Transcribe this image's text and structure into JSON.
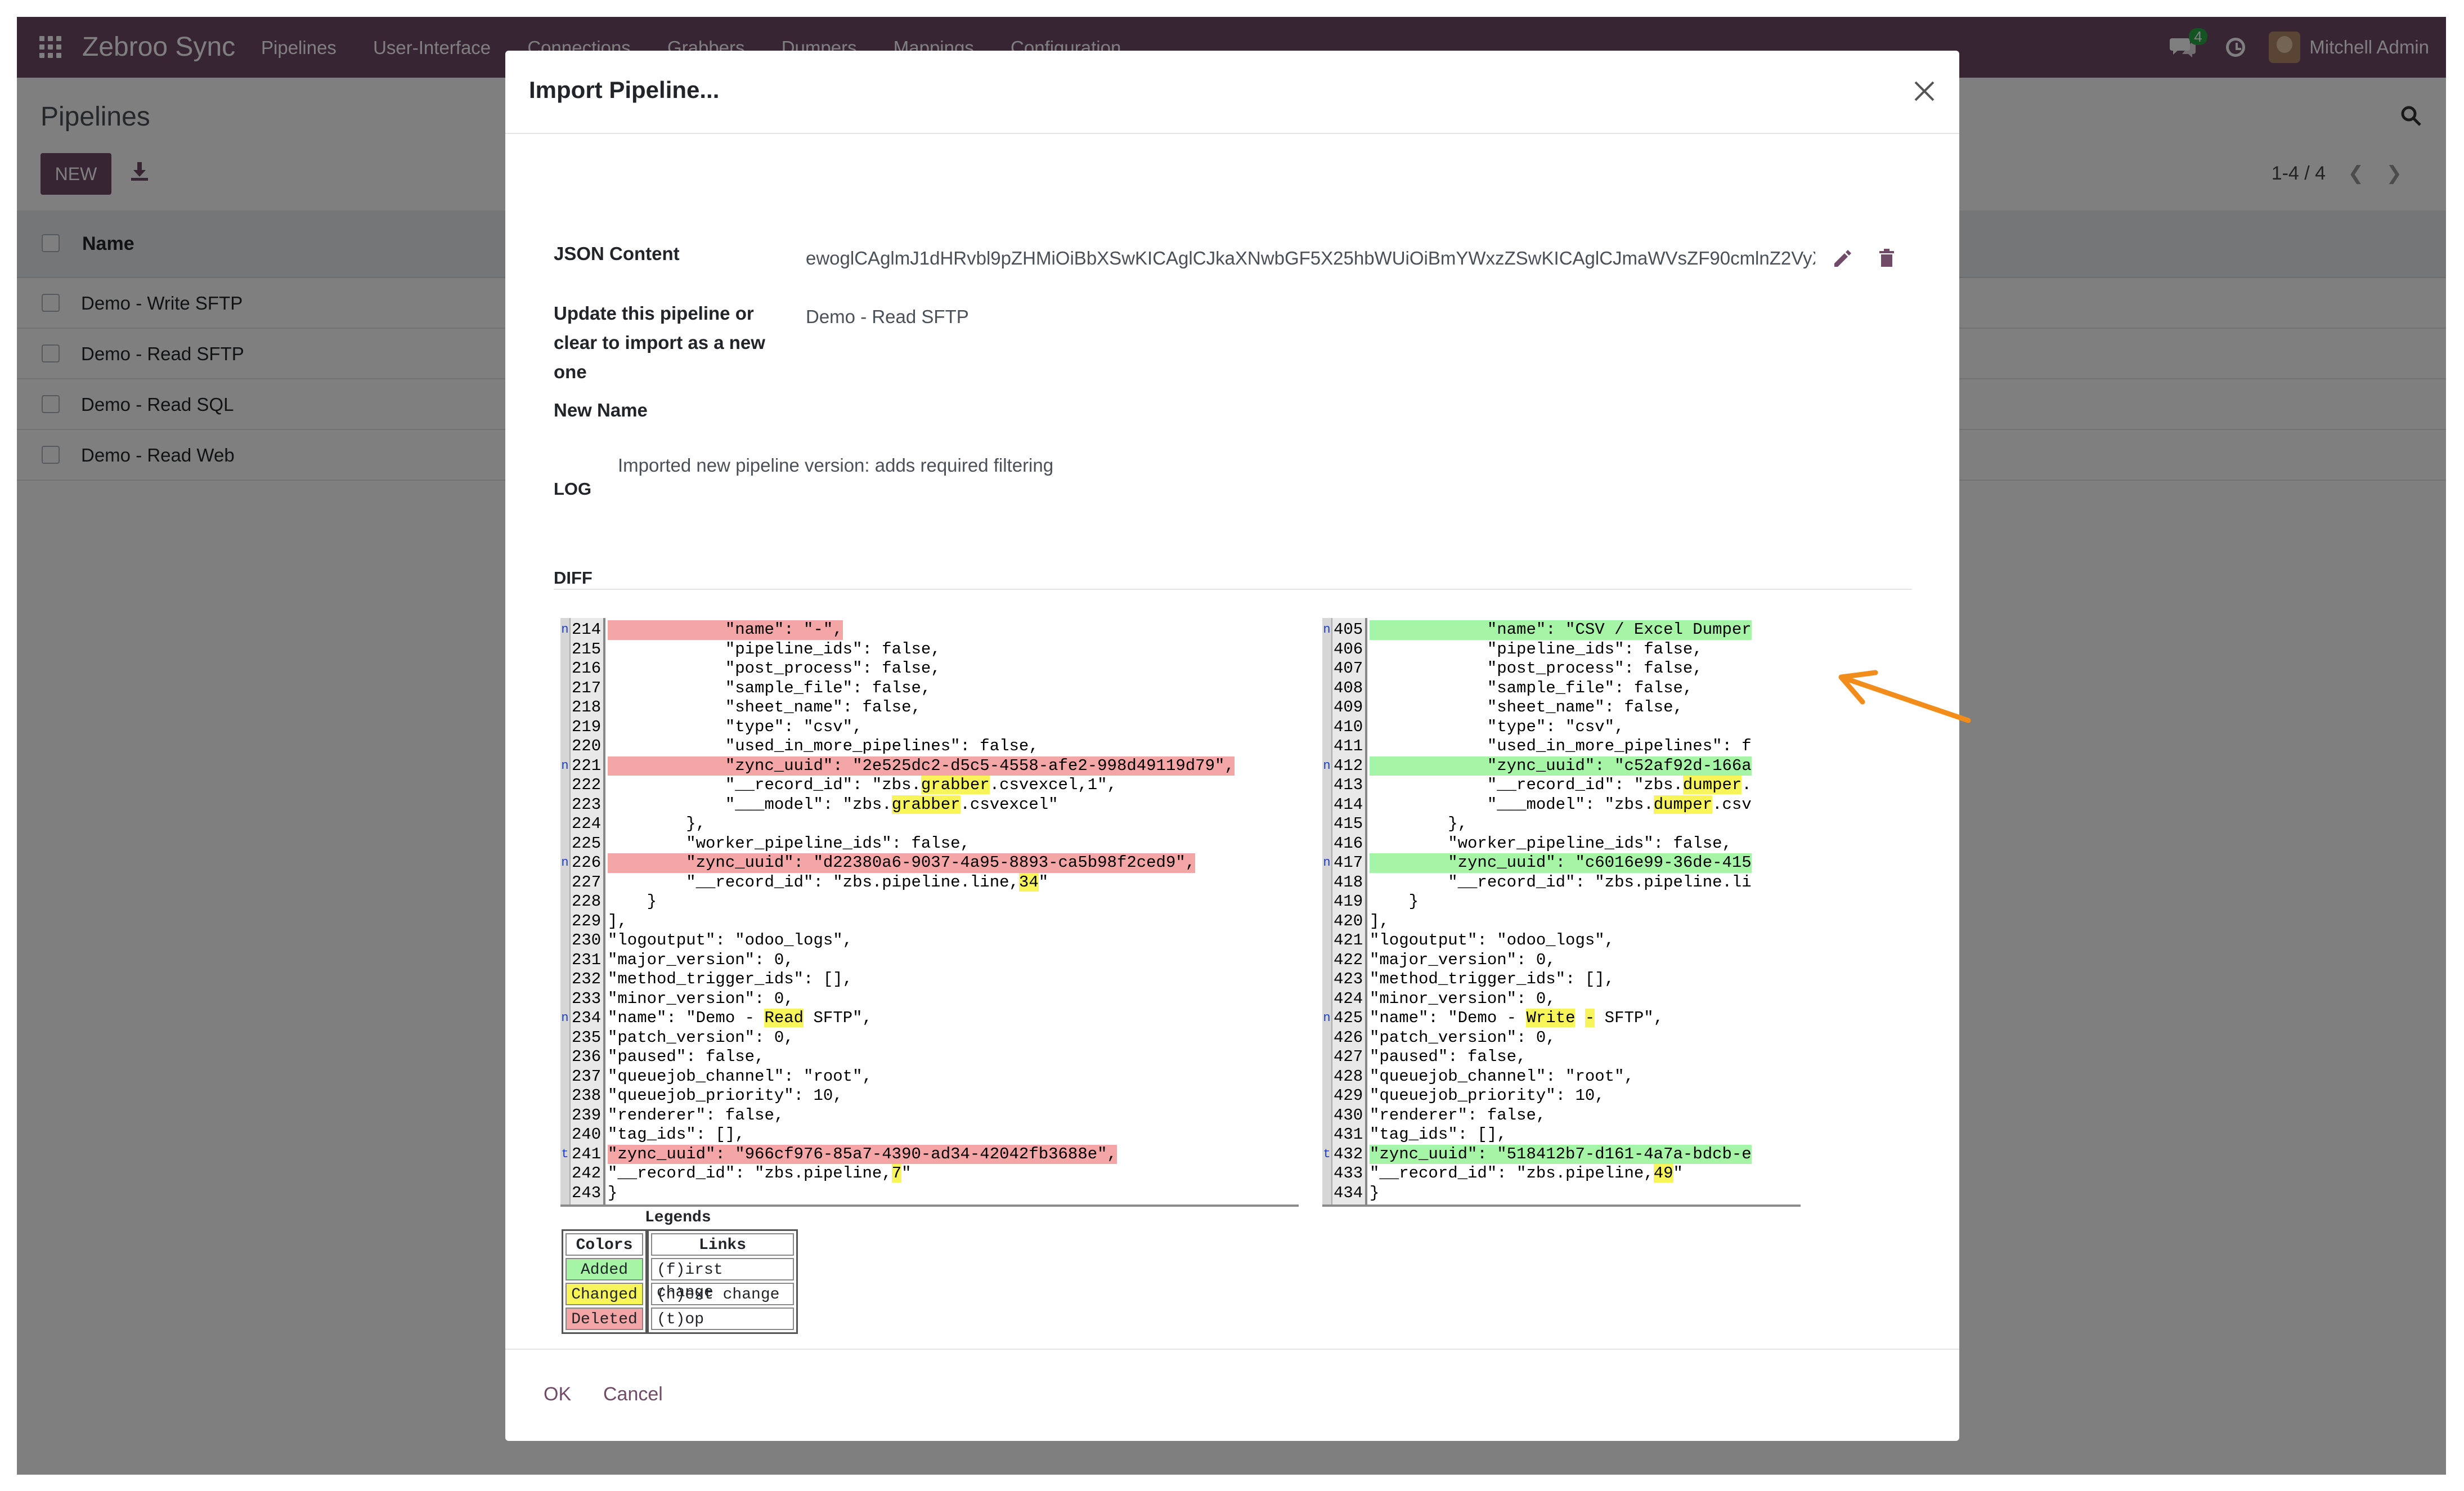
{
  "navbar": {
    "brand": "Zebroo Sync",
    "menu": [
      "Pipelines",
      "User-Interface",
      "Connections",
      "Grabbers",
      "Dumpers",
      "Mappings",
      "Configuration"
    ],
    "chat_count": "4",
    "user": "Mitchell Admin",
    "color": "#714b67"
  },
  "control": {
    "title": "Pipelines",
    "new_label": "NEW",
    "pager": "1-4 / 4"
  },
  "list": {
    "header": "Name",
    "rows": [
      "Demo - Write SFTP",
      "Demo - Read SFTP",
      "Demo - Read SQL",
      "Demo - Read Web"
    ]
  },
  "dialog": {
    "title": "Import Pipeline...",
    "json_label": "JSON Content",
    "json_value": "ewoglCAglmJ1dHRvbl9pZHMiOiBbXSwKICAglCJkaXNwbGF5X25hbWUiOiBmYWxzZSwKICAglCJmaWVsZF90cmlnZ2VyX",
    "update_label_1": "Update this pipeline or",
    "update_label_2": "clear to import as a new",
    "update_label_3": "one",
    "update_value": "Demo - Read SFTP",
    "newname_label": "New Name",
    "log_label": "LOG",
    "log_value": "Imported new pipeline version: adds required filtering",
    "diff_label": "DIFF",
    "ok_label": "OK",
    "cancel_label": "Cancel"
  },
  "diff": {
    "left": [
      {
        "n": "214",
        "t": "            \"name\": \"-\",",
        "cls": "del",
        "mark": "n"
      },
      {
        "n": "215",
        "t": "            \"pipeline_ids\": false,"
      },
      {
        "n": "216",
        "t": "            \"post_process\": false,"
      },
      {
        "n": "217",
        "t": "            \"sample_file\": false,"
      },
      {
        "n": "218",
        "t": "            \"sheet_name\": false,"
      },
      {
        "n": "219",
        "t": "            \"type\": \"csv\","
      },
      {
        "n": "220",
        "t": "            \"used_in_more_pipelines\": false,"
      },
      {
        "n": "221",
        "t": "            \"zync_uuid\": \"2e525dc2-d5c5-4558-afe2-998d49119d79\",",
        "cls": "del",
        "mark": "n"
      },
      {
        "n": "222",
        "t": "            \"__record_id\": \"zbs.grabber.csvexcel,1\","
      },
      {
        "n": "223",
        "t": "            \"___model\": \"zbs.grabber.csvexcel\""
      },
      {
        "n": "224",
        "t": "        },"
      },
      {
        "n": "225",
        "t": "        \"worker_pipeline_ids\": false,"
      },
      {
        "n": "226",
        "t": "        \"zync_uuid\": \"d22380a6-9037-4a95-8893-ca5b98f2ced9\",",
        "cls": "del",
        "mark": "n"
      },
      {
        "n": "227",
        "t": "        \"__record_id\": \"zbs.pipeline.line,34\""
      },
      {
        "n": "228",
        "t": "    }"
      },
      {
        "n": "229",
        "t": "],"
      },
      {
        "n": "230",
        "t": "\"logoutput\": \"odoo_logs\","
      },
      {
        "n": "231",
        "t": "\"major_version\": 0,"
      },
      {
        "n": "232",
        "t": "\"method_trigger_ids\": [],"
      },
      {
        "n": "233",
        "t": "\"minor_version\": 0,"
      },
      {
        "n": "234",
        "t": "\"name\": \"Demo - Read SFTP\",",
        "mark": "n"
      },
      {
        "n": "235",
        "t": "\"patch_version\": 0,"
      },
      {
        "n": "236",
        "t": "\"paused\": false,"
      },
      {
        "n": "237",
        "t": "\"queuejob_channel\": \"root\","
      },
      {
        "n": "238",
        "t": "\"queuejob_priority\": 10,"
      },
      {
        "n": "239",
        "t": "\"renderer\": false,"
      },
      {
        "n": "240",
        "t": "\"tag_ids\": [],"
      },
      {
        "n": "241",
        "t": "\"zync_uuid\": \"966cf976-85a7-4390-ad34-42042fb3688e\",",
        "cls": "del",
        "mark": "t"
      },
      {
        "n": "242",
        "t": "\"__record_id\": \"zbs.pipeline,7\""
      },
      {
        "n": "243",
        "t": "}"
      }
    ],
    "right": [
      {
        "n": "405",
        "t": "            \"name\": \"CSV / Excel Dumper",
        "cls": "add",
        "mark": "n"
      },
      {
        "n": "406",
        "t": "            \"pipeline_ids\": false,"
      },
      {
        "n": "407",
        "t": "            \"post_process\": false,"
      },
      {
        "n": "408",
        "t": "            \"sample_file\": false,"
      },
      {
        "n": "409",
        "t": "            \"sheet_name\": false,"
      },
      {
        "n": "410",
        "t": "            \"type\": \"csv\","
      },
      {
        "n": "411",
        "t": "            \"used_in_more_pipelines\": f"
      },
      {
        "n": "412",
        "t": "            \"zync_uuid\": \"c52af92d-166a",
        "cls": "add",
        "mark": "n"
      },
      {
        "n": "413",
        "t": "            \"__record_id\": \"zbs.dumper."
      },
      {
        "n": "414",
        "t": "            \"___model\": \"zbs.dumper.csv"
      },
      {
        "n": "415",
        "t": "        },"
      },
      {
        "n": "416",
        "t": "        \"worker_pipeline_ids\": false,"
      },
      {
        "n": "417",
        "t": "        \"zync_uuid\": \"c6016e99-36de-415",
        "cls": "add",
        "mark": "n"
      },
      {
        "n": "418",
        "t": "        \"__record_id\": \"zbs.pipeline.li"
      },
      {
        "n": "419",
        "t": "    }"
      },
      {
        "n": "420",
        "t": "],"
      },
      {
        "n": "421",
        "t": "\"logoutput\": \"odoo_logs\","
      },
      {
        "n": "422",
        "t": "\"major_version\": 0,"
      },
      {
        "n": "423",
        "t": "\"method_trigger_ids\": [],"
      },
      {
        "n": "424",
        "t": "\"minor_version\": 0,"
      },
      {
        "n": "425",
        "t": "\"name\": \"Demo - Write - SFTP\",",
        "mark": "n"
      },
      {
        "n": "426",
        "t": "\"patch_version\": 0,"
      },
      {
        "n": "427",
        "t": "\"paused\": false,"
      },
      {
        "n": "428",
        "t": "\"queuejob_channel\": \"root\","
      },
      {
        "n": "429",
        "t": "\"queuejob_priority\": 10,"
      },
      {
        "n": "430",
        "t": "\"renderer\": false,"
      },
      {
        "n": "431",
        "t": "\"tag_ids\": [],"
      },
      {
        "n": "432",
        "t": "\"zync_uuid\": \"518412b7-d161-4a7a-bdcb-e",
        "cls": "add",
        "mark": "t"
      },
      {
        "n": "433",
        "t": "\"__record_id\": \"zbs.pipeline,49\""
      },
      {
        "n": "434",
        "t": "}"
      }
    ]
  },
  "legend": {
    "title": "Legends",
    "colors_header": "Colors",
    "links_header": "Links",
    "added": "Added",
    "changed": "Changed",
    "deleted": "Deleted",
    "first": "(f)irst change",
    "next": "(n)ext change",
    "top": "(t)op"
  },
  "colors": {
    "added": "#a6f4a6",
    "deleted": "#f4a6a6",
    "changed": "#f8f55a",
    "accent": "#714b67",
    "arrow": "#f28c1a"
  }
}
